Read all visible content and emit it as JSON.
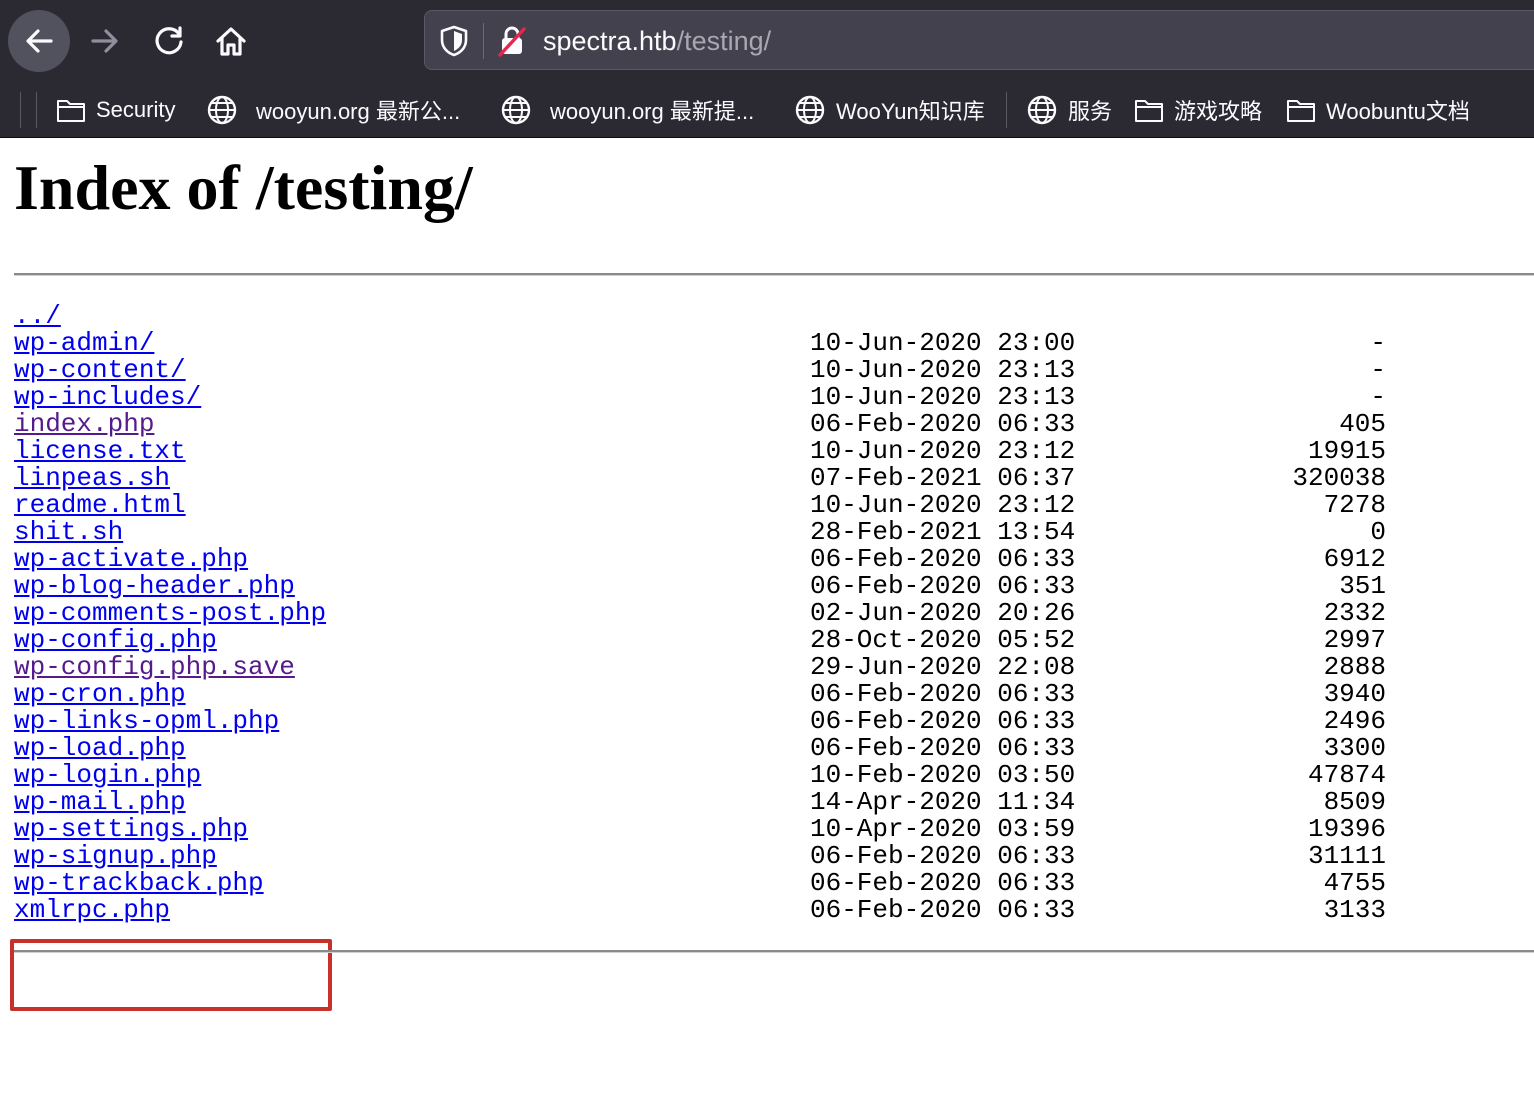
{
  "toolbar": {
    "back_icon": "back-arrow-icon",
    "forward_icon": "forward-arrow-icon",
    "reload_icon": "reload-icon",
    "home_icon": "home-icon"
  },
  "address_bar": {
    "host": "spectra.htb",
    "path": "/testing/"
  },
  "bookmarks": [
    {
      "label": "Security",
      "icon": "folder-icon"
    },
    {
      "label": "wooyun.org 最新公...",
      "icon": "globe-icon"
    },
    {
      "label": "wooyun.org 最新提...",
      "icon": "globe-icon"
    },
    {
      "label": "WooYun知识库",
      "icon": "globe-icon"
    },
    {
      "label": "服务",
      "icon": "globe-icon"
    },
    {
      "label": "游戏攻略",
      "icon": "folder-icon"
    },
    {
      "label": "Woobuntu文档",
      "icon": "folder-icon"
    }
  ],
  "page": {
    "title": "Index of /testing/"
  },
  "listing": [
    {
      "name": "../",
      "date": "",
      "size": "",
      "visited": false
    },
    {
      "name": "wp-admin/",
      "date": "10-Jun-2020 23:00",
      "size": "-",
      "visited": false
    },
    {
      "name": "wp-content/",
      "date": "10-Jun-2020 23:13",
      "size": "-",
      "visited": false
    },
    {
      "name": "wp-includes/",
      "date": "10-Jun-2020 23:13",
      "size": "-",
      "visited": false
    },
    {
      "name": "index.php",
      "date": "06-Feb-2020 06:33",
      "size": "405",
      "visited": true
    },
    {
      "name": "license.txt",
      "date": "10-Jun-2020 23:12",
      "size": "19915",
      "visited": false
    },
    {
      "name": "linpeas.sh",
      "date": "07-Feb-2021 06:37",
      "size": "320038",
      "visited": false
    },
    {
      "name": "readme.html",
      "date": "10-Jun-2020 23:12",
      "size": "7278",
      "visited": false
    },
    {
      "name": "shit.sh",
      "date": "28-Feb-2021 13:54",
      "size": "0",
      "visited": false
    },
    {
      "name": "wp-activate.php",
      "date": "06-Feb-2020 06:33",
      "size": "6912",
      "visited": false
    },
    {
      "name": "wp-blog-header.php",
      "date": "06-Feb-2020 06:33",
      "size": "351",
      "visited": false
    },
    {
      "name": "wp-comments-post.php",
      "date": "02-Jun-2020 20:26",
      "size": "2332",
      "visited": false
    },
    {
      "name": "wp-config.php",
      "date": "28-Oct-2020 05:52",
      "size": "2997",
      "visited": false
    },
    {
      "name": "wp-config.php.save",
      "date": "29-Jun-2020 22:08",
      "size": "2888",
      "visited": true
    },
    {
      "name": "wp-cron.php",
      "date": "06-Feb-2020 06:33",
      "size": "3940",
      "visited": false
    },
    {
      "name": "wp-links-opml.php",
      "date": "06-Feb-2020 06:33",
      "size": "2496",
      "visited": false
    },
    {
      "name": "wp-load.php",
      "date": "06-Feb-2020 06:33",
      "size": "3300",
      "visited": false
    },
    {
      "name": "wp-login.php",
      "date": "10-Feb-2020 03:50",
      "size": "47874",
      "visited": false
    },
    {
      "name": "wp-mail.php",
      "date": "14-Apr-2020 11:34",
      "size": "8509",
      "visited": false
    },
    {
      "name": "wp-settings.php",
      "date": "10-Apr-2020 03:59",
      "size": "19396",
      "visited": false
    },
    {
      "name": "wp-signup.php",
      "date": "06-Feb-2020 06:33",
      "size": "31111",
      "visited": false
    },
    {
      "name": "wp-trackback.php",
      "date": "06-Feb-2020 06:33",
      "size": "4755",
      "visited": false
    },
    {
      "name": "xmlrpc.php",
      "date": "06-Feb-2020 06:33",
      "size": "3133",
      "visited": false
    }
  ],
  "colors": {
    "link": "#0000ee",
    "visited_link": "#551a8b",
    "highlight_box": "#c8312a",
    "chrome_bg": "#2b2a33",
    "urlbar_bg": "#42414d"
  }
}
